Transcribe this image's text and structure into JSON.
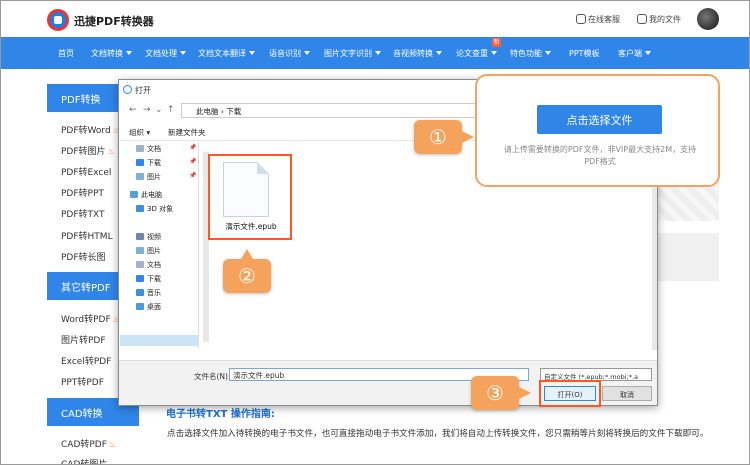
{
  "header": {
    "brand": "迅捷PDF转换器",
    "service": "在线客服",
    "my_files": "我的文件"
  },
  "nav": {
    "items": [
      "首页",
      "文档转换",
      "文档处理",
      "文档文本翻译",
      "语音识别",
      "图片文字识别",
      "音视频转换",
      "论文查重",
      "特色功能",
      "PPT模板",
      "客户端"
    ],
    "badge": "新"
  },
  "sidebar": {
    "section1": "PDF转换",
    "section1_items": [
      "PDF转Word",
      "PDF转图片",
      "PDF转Excel",
      "PDF转PPT",
      "PDF转TXT",
      "PDF转HTML",
      "PDF转长图"
    ],
    "section2": "其它转PDF",
    "section2_items": [
      "Word转PDF",
      "图片转PDF",
      "Excel转PDF",
      "PPT转PDF"
    ],
    "section3": "CAD转换",
    "section3_items": [
      "CAD转PDF",
      "CAD转图片"
    ]
  },
  "dialog": {
    "title": "打开",
    "address": "此电脑 › 下载",
    "organize": "组织 ▾",
    "new_folder": "新建文件夹",
    "tree": [
      "文档",
      "下载",
      "图片",
      "此电脑",
      "3D 对象",
      "视频",
      "图片",
      "文档",
      "下载",
      "音乐",
      "桌面"
    ],
    "file_name": "演示文件.epub",
    "filename_label": "文件名(N):",
    "filename_value": "演示文件.epub",
    "filetype": "自定义文件 (*.epub;*.mobi;*.a",
    "open": "打开(O)",
    "cancel": "取消"
  },
  "upload": {
    "button": "点击选择文件",
    "hint": "请上传需要转换的PDF文件，非VIP最大支持2M，支持PDF格式"
  },
  "steps": [
    "①",
    "②",
    "③"
  ],
  "guide": {
    "title": "电子书转TXT 操作指南:",
    "text": "点击选择文件加入待转换的电子书文件，也可直接拖动电子书文件添加，我们将自动上传转换文件，您只需稍等片刻将转换后的文件下载即可。"
  },
  "colors": {
    "primary": "#2f86e8",
    "accent": "#f5a35c",
    "highlight": "#ff5722"
  }
}
